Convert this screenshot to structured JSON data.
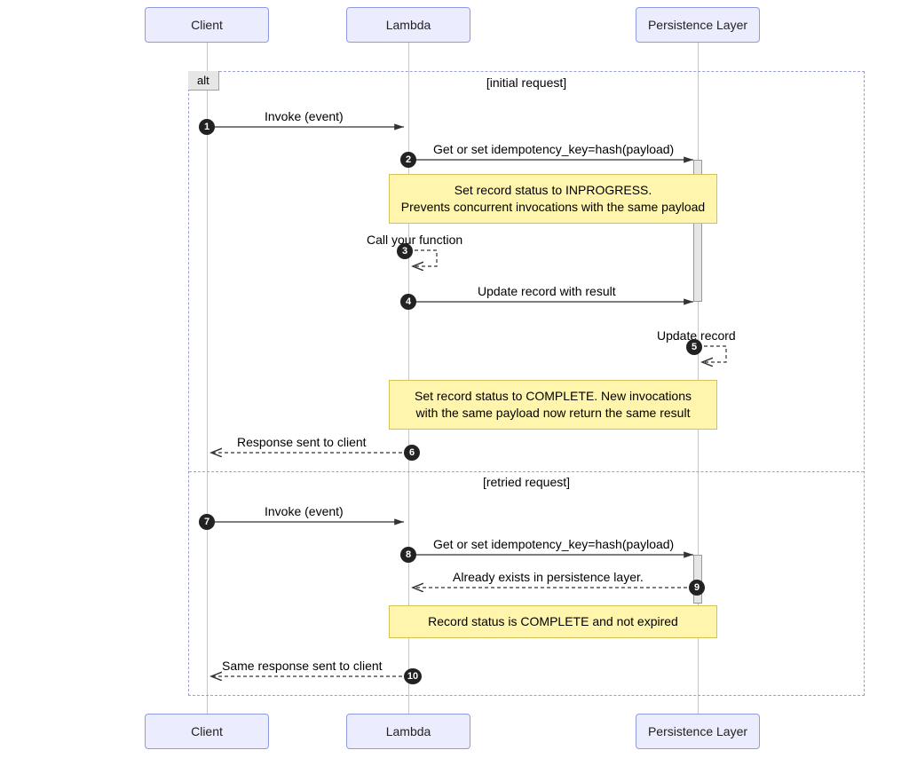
{
  "chart_data": {
    "type": "sequence-diagram",
    "participants": [
      "Client",
      "Lambda",
      "Persistence Layer"
    ],
    "alt_label": "alt",
    "sections": [
      {
        "name": "[initial request]",
        "messages": [
          {
            "n": 1,
            "from": "Client",
            "to": "Lambda",
            "text": "Invoke (event)",
            "style": "solid"
          },
          {
            "n": 2,
            "from": "Lambda",
            "to": "Persistence Layer",
            "text": "Get or set idempotency_key=hash(payload)",
            "style": "solid"
          },
          {
            "note": "Set record status to INPROGRESS.\nPrevents concurrent invocations with the same payload",
            "over": [
              "Lambda",
              "Persistence Layer"
            ]
          },
          {
            "n": 3,
            "from": "Lambda",
            "to": "Lambda",
            "text": "Call your function",
            "style": "dashed"
          },
          {
            "n": 4,
            "from": "Lambda",
            "to": "Persistence Layer",
            "text": "Update record with result",
            "style": "solid"
          },
          {
            "n": 5,
            "from": "Persistence Layer",
            "to": "Persistence Layer",
            "text": "Update record",
            "style": "dashed"
          },
          {
            "note": "Set record status to COMPLETE. New invocations\nwith the same payload now return the same result",
            "over": [
              "Lambda",
              "Persistence Layer"
            ]
          },
          {
            "n": 6,
            "from": "Lambda",
            "to": "Client",
            "text": "Response sent to client",
            "style": "dashed"
          }
        ]
      },
      {
        "name": "[retried request]",
        "messages": [
          {
            "n": 7,
            "from": "Client",
            "to": "Lambda",
            "text": "Invoke (event)",
            "style": "solid"
          },
          {
            "n": 8,
            "from": "Lambda",
            "to": "Persistence Layer",
            "text": "Get or set idempotency_key=hash(payload)",
            "style": "solid"
          },
          {
            "n": 9,
            "from": "Persistence Layer",
            "to": "Lambda",
            "text": "Already exists in persistence layer.",
            "style": "dashed"
          },
          {
            "note": "Record status is COMPLETE and not expired",
            "over": [
              "Lambda",
              "Persistence Layer"
            ]
          },
          {
            "n": 10,
            "from": "Lambda",
            "to": "Client",
            "text": "Same response sent to client",
            "style": "dashed"
          }
        ]
      }
    ]
  },
  "actors": {
    "client": "Client",
    "lambda": "Lambda",
    "persistence": "Persistence Layer"
  },
  "alt": {
    "label": "alt",
    "section1": "[initial request]",
    "section2": "[retried request]"
  },
  "msg": {
    "m1": "Invoke (event)",
    "m2": "Get or set idempotency_key=hash(payload)",
    "note1a": "Set record status to INPROGRESS.",
    "note1b": "Prevents concurrent invocations with the same payload",
    "m3": "Call your function",
    "m4": "Update record with result",
    "m5": "Update record",
    "note2a": "Set record status to COMPLETE. New invocations",
    "note2b": "with the same payload now return the same result",
    "m6": "Response sent to client",
    "m7": "Invoke (event)",
    "m8": "Get or set idempotency_key=hash(payload)",
    "m9": "Already exists in persistence layer.",
    "note3": "Record status is COMPLETE and not expired",
    "m10": "Same response sent to client"
  },
  "nums": {
    "n1": "1",
    "n2": "2",
    "n3": "3",
    "n4": "4",
    "n5": "5",
    "n6": "6",
    "n7": "7",
    "n8": "8",
    "n9": "9",
    "n10": "10"
  }
}
